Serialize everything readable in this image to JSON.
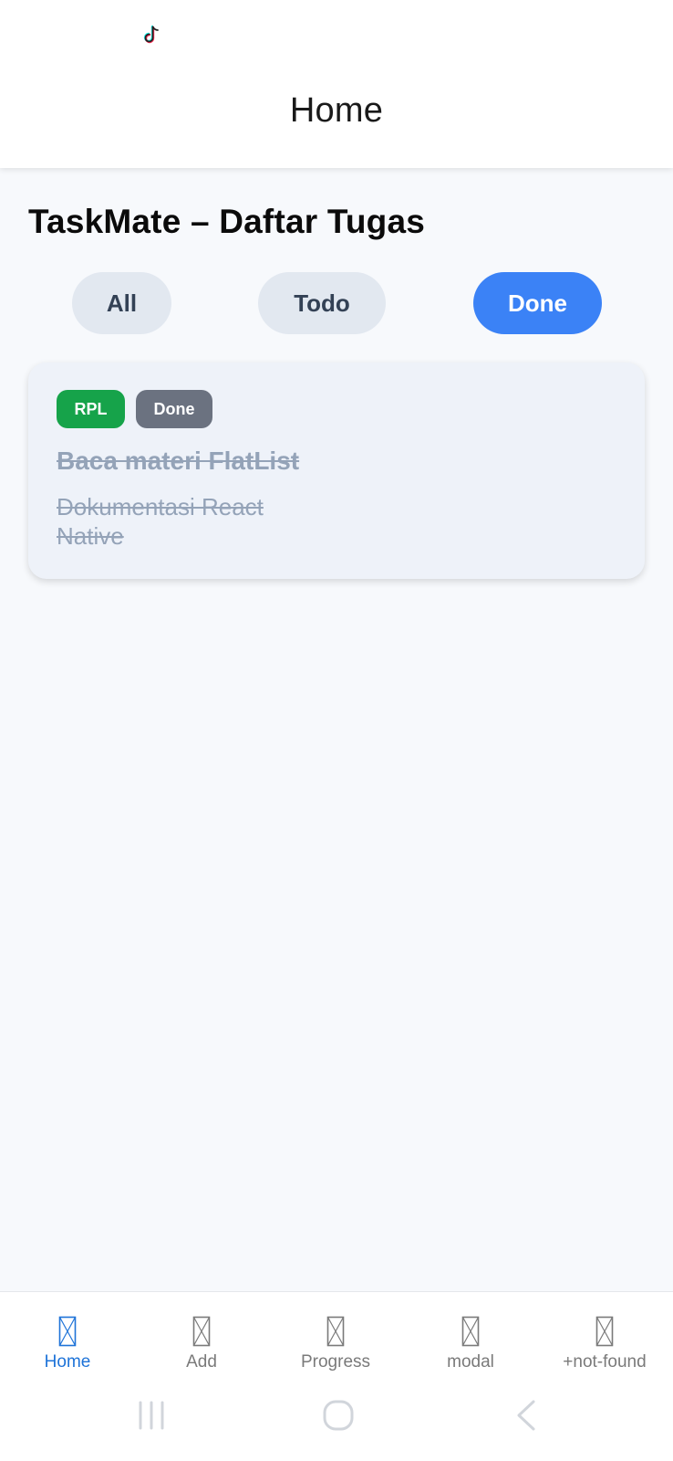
{
  "header": {
    "title": "Home"
  },
  "page": {
    "title": "TaskMate – Daftar Tugas"
  },
  "filters": {
    "all": "All",
    "todo": "Todo",
    "done": "Done",
    "active": "Done"
  },
  "task": {
    "category": "RPL",
    "status": "Done",
    "title": "Baca materi FlatList",
    "description": "Dokumentasi React Native"
  },
  "tabs": {
    "home": "Home",
    "add": "Add",
    "progress": "Progress",
    "modal": "modal",
    "not_found": "+not-found",
    "active": "Home"
  },
  "colors": {
    "accent": "#3B82F6",
    "tab_active": "#1E73D8",
    "category_badge": "#16A34A",
    "status_badge": "#6B7280",
    "completed_text": "#94A3B8"
  },
  "icons": {
    "status": "tiktok-icon",
    "tab": "missing-glyph-icon",
    "nav_recents": "recents-icon",
    "nav_home": "home-circle-icon",
    "nav_back": "back-chevron-icon"
  }
}
